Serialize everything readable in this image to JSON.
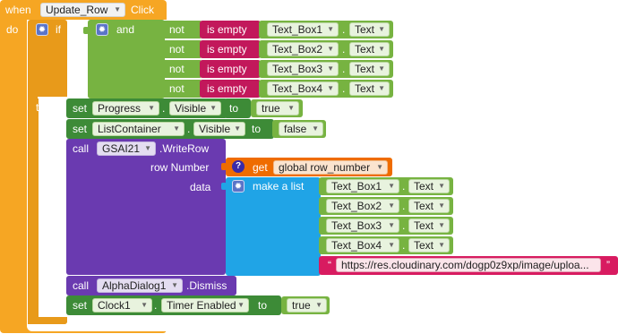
{
  "event": {
    "when": "when",
    "component": "Update_Row",
    "event_name": "Click",
    "do": "do"
  },
  "if_block": {
    "if": "if",
    "then": "then",
    "and": "and"
  },
  "conditions": [
    {
      "not": "not",
      "is_empty": "is empty",
      "component": "Text_Box1",
      "property": "Text"
    },
    {
      "not": "not",
      "is_empty": "is empty",
      "component": "Text_Box2",
      "property": "Text"
    },
    {
      "not": "not",
      "is_empty": "is empty",
      "component": "Text_Box3",
      "property": "Text"
    },
    {
      "not": "not",
      "is_empty": "is empty",
      "component": "Text_Box4",
      "property": "Text"
    }
  ],
  "set_progress": {
    "set": "set",
    "component": "Progress",
    "property": "Visible",
    "to": "to",
    "value": "true"
  },
  "set_list": {
    "set": "set",
    "component": "ListContainer",
    "property": "Visible",
    "to": "to",
    "value": "false"
  },
  "call_write": {
    "call": "call",
    "component": "GSAI21",
    "method": ".WriteRow",
    "row_number_label": "row Number",
    "data_label": "data",
    "get": "get",
    "variable": "global row_number",
    "make_list": "make a list"
  },
  "list_items": [
    {
      "component": "Text_Box1",
      "property": "Text"
    },
    {
      "component": "Text_Box2",
      "property": "Text"
    },
    {
      "component": "Text_Box3",
      "property": "Text"
    },
    {
      "component": "Text_Box4",
      "property": "Text"
    }
  ],
  "url_string": {
    "open_quote": "“",
    "value": "https://res.cloudinary.com/dogp0z9xp/image/uploa...",
    "close_quote": "”"
  },
  "call_dismiss": {
    "call": "call",
    "component": "AlphaDialog1",
    "method": ".Dismiss"
  },
  "set_clock": {
    "set": "set",
    "component": "Clock1",
    "property": "Timer Enabled",
    "to": "to",
    "value": "true"
  },
  "colors": {
    "event": "#f6a623",
    "control": "#e89a1a",
    "logic": "#77b341",
    "text": "#c2185b",
    "set": "#3d8b37",
    "call": "#6a3ab0",
    "get": "#ef6c00",
    "list": "#20a4e6",
    "string": "#d81b60"
  }
}
